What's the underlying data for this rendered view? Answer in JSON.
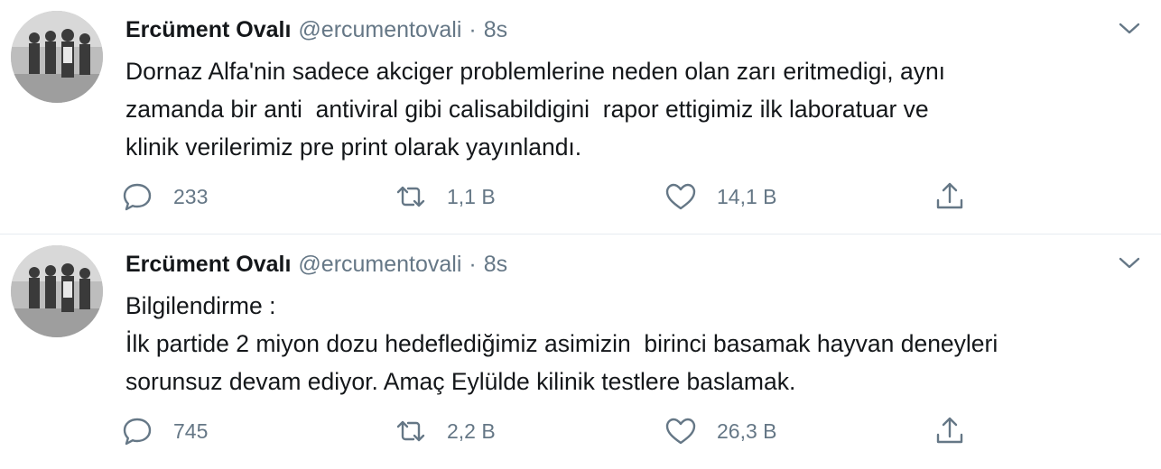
{
  "tweets": [
    {
      "author_name": "Ercüment Ovalı",
      "handle": "@ercumentovali",
      "separator": "·",
      "time": "8s",
      "text": "Dornaz Alfa'nin sadece akciger problemlerine neden olan zarı eritmedigi, aynı\nzamanda bir anti  antiviral gibi calisabildigini  rapor ettigimiz ilk laboratuar ve\nklinik verilerimiz pre print olarak yayınlandı.",
      "replies": "233",
      "retweets": "1,1 B",
      "likes": "14,1 B"
    },
    {
      "author_name": "Ercüment Ovalı",
      "handle": "@ercumentovali",
      "separator": "·",
      "time": "8s",
      "text": "Bilgilendirme :\nİlk partide 2 miyon dozu hedeflediğimiz asimizin  birinci basamak hayvan deneyleri\nsorunsuz devam ediyor. Amaç Eylülde kilinik testlere baslamak.",
      "replies": "745",
      "retweets": "2,2 B",
      "likes": "26,3 B"
    }
  ],
  "icons": {
    "reply": "speech-bubble-icon",
    "retweet": "retweet-arrows-icon",
    "like": "heart-icon",
    "share": "share-upload-icon",
    "menu": "chevron-down-icon"
  },
  "colors": {
    "text": "#14171a",
    "secondary": "#657786",
    "divider": "#e6ecf0"
  }
}
